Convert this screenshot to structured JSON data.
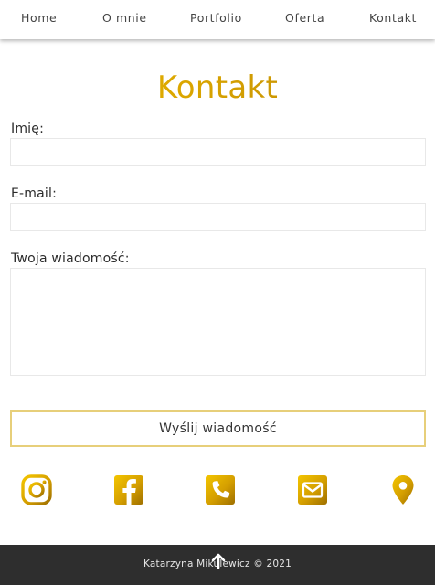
{
  "nav": {
    "items": [
      {
        "label": "Home"
      },
      {
        "label": "O mnie"
      },
      {
        "label": "Portfolio"
      },
      {
        "label": "Oferta"
      },
      {
        "label": "Kontakt"
      }
    ]
  },
  "contact": {
    "title": "Kontakt",
    "name_label": "Imię:",
    "name_value": "",
    "email_label": "E-mail:",
    "email_value": "",
    "message_label": "Twoja wiadomość:",
    "message_value": "",
    "submit_label": "Wyślij wiadomość"
  },
  "social": {
    "icons": [
      "instagram-icon",
      "facebook-icon",
      "phone-icon",
      "mail-icon",
      "location-pin-icon"
    ]
  },
  "footer": {
    "text": "Katarzyna Mikulewicz © 2021",
    "scroll_top_icon": "arrow-up-icon"
  },
  "colors": {
    "accent_gold": "#d9a400",
    "accent_gold_dark": "#b07b00",
    "footer_bg": "#2e2e2e",
    "button_border": "#e7cf7a"
  }
}
